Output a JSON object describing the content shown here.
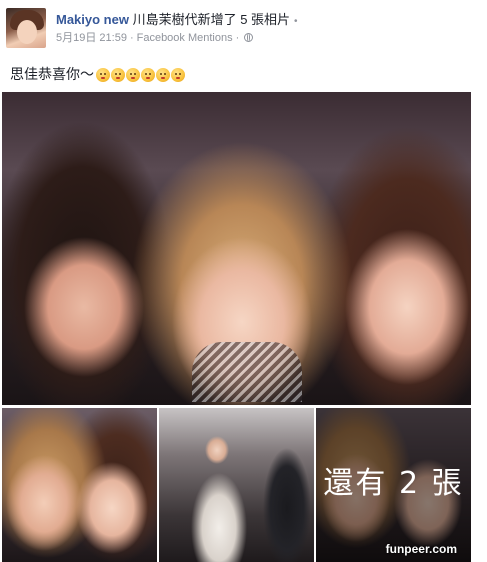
{
  "post": {
    "author": "Makiyo new",
    "action": " 川島茉樹代新增了 5 張相片",
    "date": "5月19日 21:59",
    "separator": "·",
    "via": "Facebook Mentions",
    "privacy_icon": "globe-icon",
    "text": "思佳恭喜你～",
    "emoji": [
      "kissing-face-emoji",
      "kissing-face-emoji",
      "kissing-face-emoji",
      "kissing-face-emoji",
      "kissing-face-emoji",
      "kissing-face-emoji"
    ]
  },
  "photos": {
    "more_label": "還有 2 張"
  },
  "watermark": "funpeer.com"
}
